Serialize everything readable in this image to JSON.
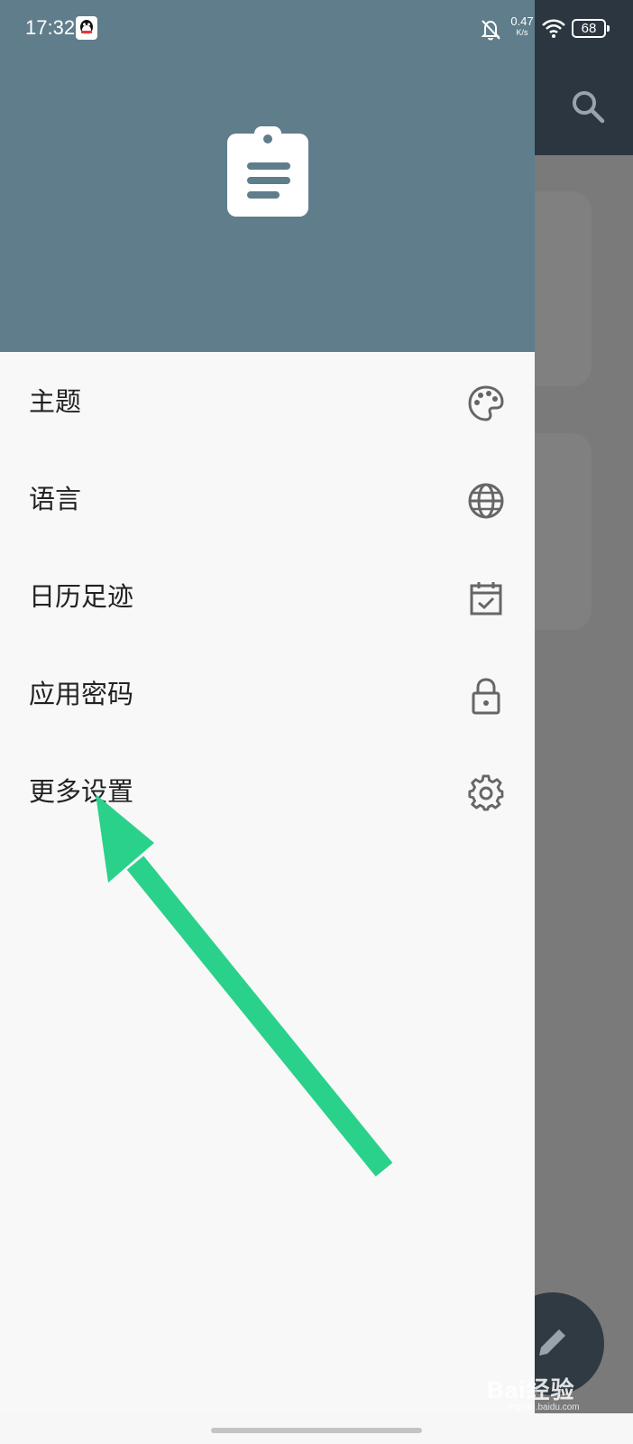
{
  "status_bar": {
    "time": "17:32",
    "net_speed_value": "0.47",
    "net_speed_unit": "K/s",
    "battery": "68",
    "icons": [
      "qq-icon",
      "bell-off-icon",
      "wifi-icon",
      "battery-icon"
    ]
  },
  "drawer": {
    "header_icon": "clipboard-icon",
    "header_color": "#607d8b",
    "items": [
      {
        "label": "主题",
        "icon": "palette-icon"
      },
      {
        "label": "语言",
        "icon": "globe-icon"
      },
      {
        "label": "日历足迹",
        "icon": "calendar-check-icon"
      },
      {
        "label": "应用密码",
        "icon": "lock-icon"
      },
      {
        "label": "更多设置",
        "icon": "gear-icon"
      }
    ]
  },
  "background_app": {
    "toolbar_color": "#2b3640",
    "icons": [
      "search-icon",
      "edit-fab-icon"
    ]
  },
  "annotation": {
    "arrow_color": "#2ad18b"
  },
  "watermark": {
    "text": "Bai经验",
    "sub": "jingyan.baidu.com"
  }
}
